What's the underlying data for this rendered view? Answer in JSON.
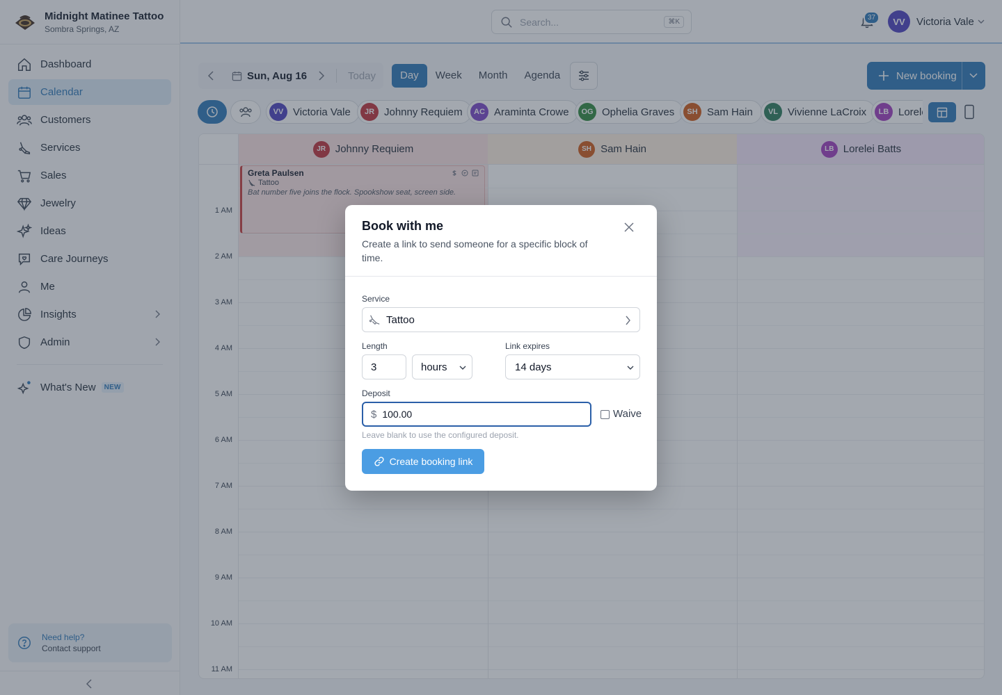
{
  "business": {
    "name": "Midnight Matinee Tattoo",
    "location": "Sombra Springs, AZ"
  },
  "sidebar": {
    "items": [
      {
        "label": "Dashboard",
        "icon": "home-icon"
      },
      {
        "label": "Calendar",
        "icon": "calendar-icon",
        "active": true
      },
      {
        "label": "Customers",
        "icon": "users-icon"
      },
      {
        "label": "Services",
        "icon": "tattoo-machine-icon"
      },
      {
        "label": "Sales",
        "icon": "cart-icon"
      },
      {
        "label": "Jewelry",
        "icon": "gem-icon"
      },
      {
        "label": "Ideas",
        "icon": "sparkles-icon"
      },
      {
        "label": "Care Journeys",
        "icon": "chat-heart-icon"
      },
      {
        "label": "Me",
        "icon": "user-icon"
      },
      {
        "label": "Insights",
        "icon": "pie-chart-icon",
        "has_submenu": true
      },
      {
        "label": "Admin",
        "icon": "shield-icon",
        "has_submenu": true
      }
    ],
    "whats_new": {
      "label": "What's New",
      "badge": "NEW"
    },
    "help": {
      "title": "Need help?",
      "link": "Contact support"
    }
  },
  "topbar": {
    "search_placeholder": "Search...",
    "search_shortcut": "⌘K",
    "notifications_count": "37",
    "user": {
      "initials": "VV",
      "name": "Victoria Vale"
    }
  },
  "toolbar": {
    "date": "Sun, Aug 16",
    "today": "Today",
    "views": [
      "Day",
      "Week",
      "Month",
      "Agenda"
    ],
    "active_view": "Day",
    "new_booking": "New booking"
  },
  "staff": [
    {
      "initials": "VV",
      "name": "Victoria Vale",
      "color": "#4b3fbf"
    },
    {
      "initials": "JR",
      "name": "Johnny Requiem",
      "color": "#c0303a"
    },
    {
      "initials": "AC",
      "name": "Araminta Crowe",
      "color": "#7b45c8"
    },
    {
      "initials": "OG",
      "name": "Ophelia Graves",
      "color": "#2f8a3d"
    },
    {
      "initials": "SH",
      "name": "Sam Hain",
      "color": "#d05a17"
    },
    {
      "initials": "VL",
      "name": "Vivienne LaCroix",
      "color": "#2a7a5a"
    },
    {
      "initials": "LB",
      "name": "Lorelei Batts",
      "color": "#a13cbf"
    }
  ],
  "calendar": {
    "columns": [
      {
        "initials": "JR",
        "name": "Johnny Requiem",
        "color": "#c0303a",
        "bg": "#fbe7e7",
        "head_bg": "#fbe2e2"
      },
      {
        "initials": "SH",
        "name": "Sam Hain",
        "color": "#d05a17",
        "bg": "#ffffff",
        "head_bg": "#fdeee0"
      },
      {
        "initials": "LB",
        "name": "Lorelei Batts",
        "color": "#a13cbf",
        "bg": "#f7eefb",
        "head_bg": "#f4e6fa"
      }
    ],
    "hours": [
      "1 AM",
      "2 AM",
      "3 AM",
      "4 AM",
      "5 AM",
      "6 AM",
      "7 AM",
      "8 AM",
      "9 AM",
      "10 AM",
      "11 AM"
    ],
    "appointment": {
      "client": "Greta Paulsen",
      "service": "Tattoo",
      "note": "Bat number five joins the flock. Spookshow seat, screen side."
    }
  },
  "modal": {
    "title": "Book with me",
    "subtitle": "Create a link to send someone for a specific block of time.",
    "service_label": "Service",
    "service_value": "Tattoo",
    "length_label": "Length",
    "length_value": "3",
    "length_unit": "hours",
    "expires_label": "Link expires",
    "expires_value": "14 days",
    "deposit_label": "Deposit",
    "deposit_currency": "$",
    "deposit_value": "100.00",
    "waive_label": "Waive",
    "hint": "Leave blank to use the configured deposit.",
    "create_button": "Create booking link"
  }
}
